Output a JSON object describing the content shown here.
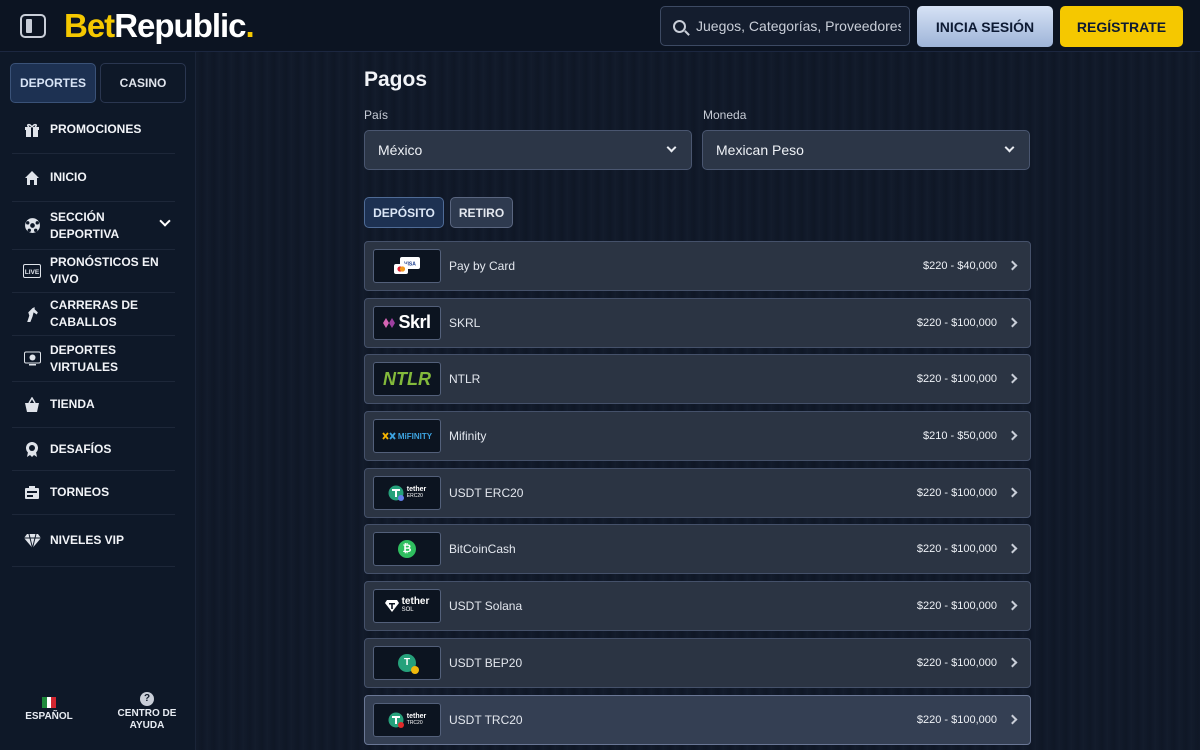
{
  "header": {
    "logo_bet": "Bet",
    "logo_rep": "Republic",
    "logo_dot": ".",
    "search_placeholder": "Juegos, Categorías, Proveedores",
    "login_label": "INICIA SESIÓN",
    "register_label": "REGÍSTRATE"
  },
  "sidebar": {
    "tabs": [
      "DEPORTES",
      "CASINO"
    ],
    "items": [
      {
        "label": "PROMOCIONES",
        "icon": "gift-icon"
      },
      {
        "label": "INICIO",
        "icon": "home-icon"
      },
      {
        "label": "SECCIÓN DEPORTIVA",
        "icon": "soccer-ball-icon"
      },
      {
        "label": "PRONÓSTICOS EN VIVO",
        "icon": "live-icon"
      },
      {
        "label": "CARRERAS DE CABALLOS",
        "icon": "horse-icon"
      },
      {
        "label": "DEPORTES VIRTUALES",
        "icon": "virtual-sports-icon"
      },
      {
        "label": "TIENDA",
        "icon": "shopping-basket-icon"
      },
      {
        "label": "DESAFÍOS",
        "icon": "badge-icon"
      },
      {
        "label": "TORNEOS",
        "icon": "tournament-icon"
      },
      {
        "label": "NIVELES VIP",
        "icon": "diamond-icon"
      }
    ],
    "bottom": {
      "language": "ESPAÑOL",
      "help": "CENTRO DE AYUDA",
      "help_glyph": "?"
    }
  },
  "main": {
    "title": "Pagos",
    "country_label": "País",
    "country_value": "México",
    "currency_label": "Moneda",
    "currency_value": "Mexican Peso",
    "tabs": [
      "DEPÓSITO",
      "RETIRO"
    ],
    "methods": [
      {
        "name": "Pay by Card",
        "range": "$220 - $40,000",
        "logo": "card-logo",
        "logo_text": "VISA"
      },
      {
        "name": "SKRL",
        "range": "$220 - $100,000",
        "logo": "skrill-logo",
        "logo_text": "Skrl"
      },
      {
        "name": "NTLR",
        "range": "$220 - $100,000",
        "logo": "neteller-logo",
        "logo_text": "NTLR"
      },
      {
        "name": "Mifinity",
        "range": "$210 - $50,000",
        "logo": "mifinity-logo",
        "logo_text": "MiFINITY"
      },
      {
        "name": "USDT ERC20",
        "range": "$220 - $100,000",
        "logo": "tether-erc20-logo",
        "logo_text": "tether",
        "logo_sub": "ERC20"
      },
      {
        "name": "BitCoinCash",
        "range": "$220 - $100,000",
        "logo": "bitcoincash-logo",
        "logo_text": "₿"
      },
      {
        "name": "USDT Solana",
        "range": "$220 - $100,000",
        "logo": "tether-sol-logo",
        "logo_text": "tether",
        "logo_sub": "SOL"
      },
      {
        "name": "USDT BEP20",
        "range": "$220 - $100,000",
        "logo": "tether-bep20-logo",
        "logo_text": "T"
      },
      {
        "name": "USDT TRC20",
        "range": "$220 - $100,000",
        "logo": "tether-trc20-logo",
        "logo_text": "tether",
        "logo_sub": "TRC20"
      }
    ]
  },
  "colors": {
    "accent": "#f5c800",
    "background": "#0f1726",
    "row": "#2b3443"
  }
}
